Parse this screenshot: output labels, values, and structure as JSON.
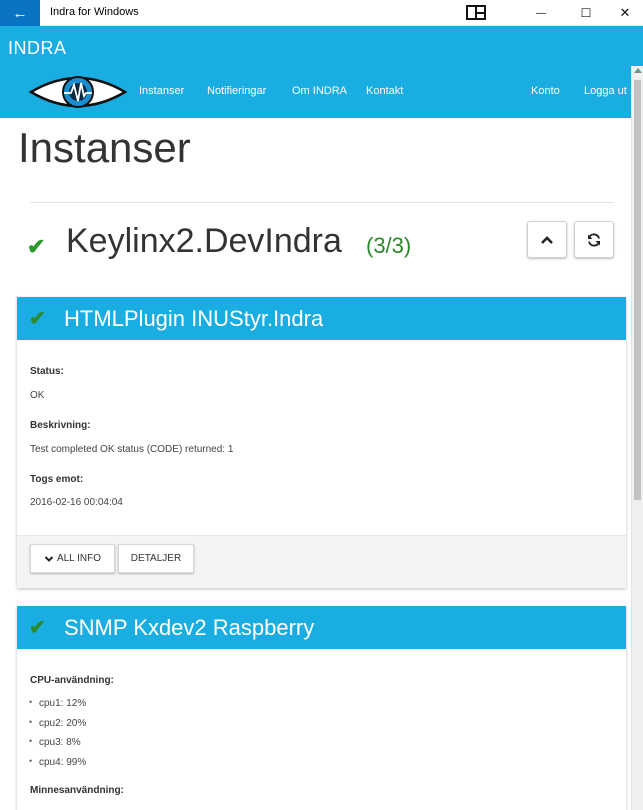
{
  "window": {
    "title": "Indra for Windows",
    "back_symbol": "←",
    "minimize_symbol": "—",
    "maximize_symbol": "☐",
    "close_symbol": "✕"
  },
  "header": {
    "brand": "INDRA",
    "nav": [
      "Instanser",
      "Notifieringar",
      "Om INDRA",
      "Kontakt"
    ],
    "account": "Konto",
    "logout": "Logga ut"
  },
  "page": {
    "title": "Instanser"
  },
  "instance": {
    "check": "✔",
    "name": "Keylinx2.DevIndra",
    "count": "(3/3)"
  },
  "panels": [
    {
      "check": "✔",
      "title": "HTMLPlugin INUStyr.Indra",
      "fields": [
        {
          "label": "Status:",
          "value": "OK"
        },
        {
          "label": "Beskrivning:",
          "value": "Test completed OK status (CODE) returned: 1"
        },
        {
          "label": "Togs emot:",
          "value": "2016-02-16 00:04:04"
        }
      ],
      "buttons": {
        "all_info_icon": "chevron-down-icon",
        "all_info": "ALL INFO",
        "details": "DETALJER"
      }
    },
    {
      "check": "✔",
      "title": "SNMP Kxdev2 Raspberry",
      "cpu_label": "CPU-användning:",
      "cpu": [
        "cpu1: 12%",
        "cpu2: 20%",
        "cpu3: 8%",
        "cpu4: 99%"
      ],
      "memory_label": "Minnesanvändning:"
    }
  ],
  "colors": {
    "accent": "#1aade1",
    "titlebar_back": "#0a74c4",
    "ok_green": "#2a9a2a"
  }
}
